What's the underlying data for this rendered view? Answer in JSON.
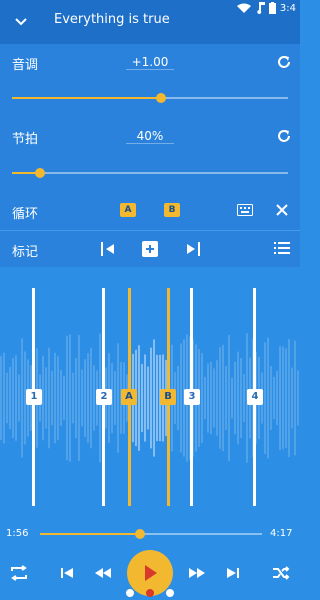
{
  "status": {
    "time": "3:4"
  },
  "header": {
    "title": "Everything is true"
  },
  "pitch": {
    "label": "音调",
    "value": "+1.00",
    "fill_percent": 54
  },
  "tempo": {
    "label": "节拍",
    "value": "40%",
    "fill_percent": 10
  },
  "loop": {
    "label": "循环",
    "a_label": "A",
    "b_label": "B"
  },
  "marks": {
    "label": "标记"
  },
  "markers": [
    {
      "label": "1"
    },
    {
      "label": "2"
    },
    {
      "label": "A"
    },
    {
      "label": "B"
    },
    {
      "label": "3"
    },
    {
      "label": "4"
    }
  ],
  "playback": {
    "current": "1:56",
    "total": "4:17",
    "progress_percent": 45
  },
  "colors": {
    "accent": "#f2b830",
    "header": "#1e6fc8",
    "background": "#2d8ee6"
  }
}
